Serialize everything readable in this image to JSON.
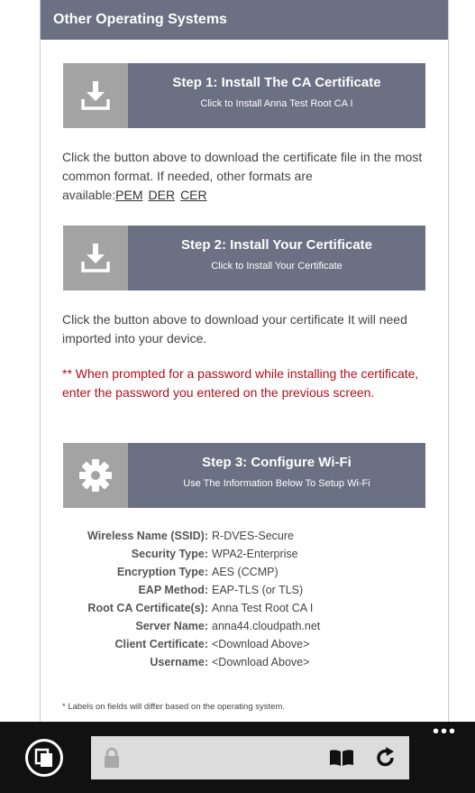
{
  "section": {
    "title": "Other Operating Systems"
  },
  "steps": [
    {
      "title": "Step 1: Install The CA Certificate",
      "subtitle": "Click to Install Anna Test Root CA I",
      "icon": "download-icon"
    },
    {
      "title": "Step 2: Install Your Certificate",
      "subtitle": "Click to Install Your Certificate",
      "icon": "download-icon"
    },
    {
      "title": "Step 3: Configure Wi-Fi",
      "subtitle": "Use The Information Below To Setup Wi-Fi",
      "icon": "gear-icon"
    }
  ],
  "step1_text": {
    "lead": "Click the button above to download the certificate file in the most common format. If needed, other formats are available:",
    "formats": [
      "PEM",
      "DER",
      "CER"
    ]
  },
  "step2_text": "Click the button above to download your certificate It will need imported into your device.",
  "warning": "** When prompted for a password while installing the certificate, enter the password you entered on the previous screen.",
  "wifi_info": [
    {
      "label": "Wireless Name (SSID):",
      "value": "R-DVES-Secure"
    },
    {
      "label": "Security Type:",
      "value": "WPA2-Enterprise"
    },
    {
      "label": "Encryption Type:",
      "value": "AES (CCMP)"
    },
    {
      "label": "EAP Method:",
      "value": "EAP-TLS (or TLS)"
    },
    {
      "label": "Root CA Certificate(s):",
      "value": "Anna Test Root CA I"
    },
    {
      "label": "Server Name:",
      "value": "anna44.cloudpath.net"
    },
    {
      "label": "Client Certificate:",
      "value": "<Download Above>"
    },
    {
      "label": "Username:",
      "value": "<Download Above>"
    }
  ],
  "footnote": "* Labels on fields will differ based on the operating system.",
  "browser": {
    "more": "•••",
    "icons": [
      "tabs-icon",
      "lock-icon",
      "reading-view-icon",
      "refresh-icon"
    ]
  },
  "colors": {
    "header": "#6b7082",
    "icon_box": "#a3a3a3",
    "warning": "#b0101a",
    "bottom_bar": "#111111",
    "address_bar": "#dcdcdc"
  }
}
